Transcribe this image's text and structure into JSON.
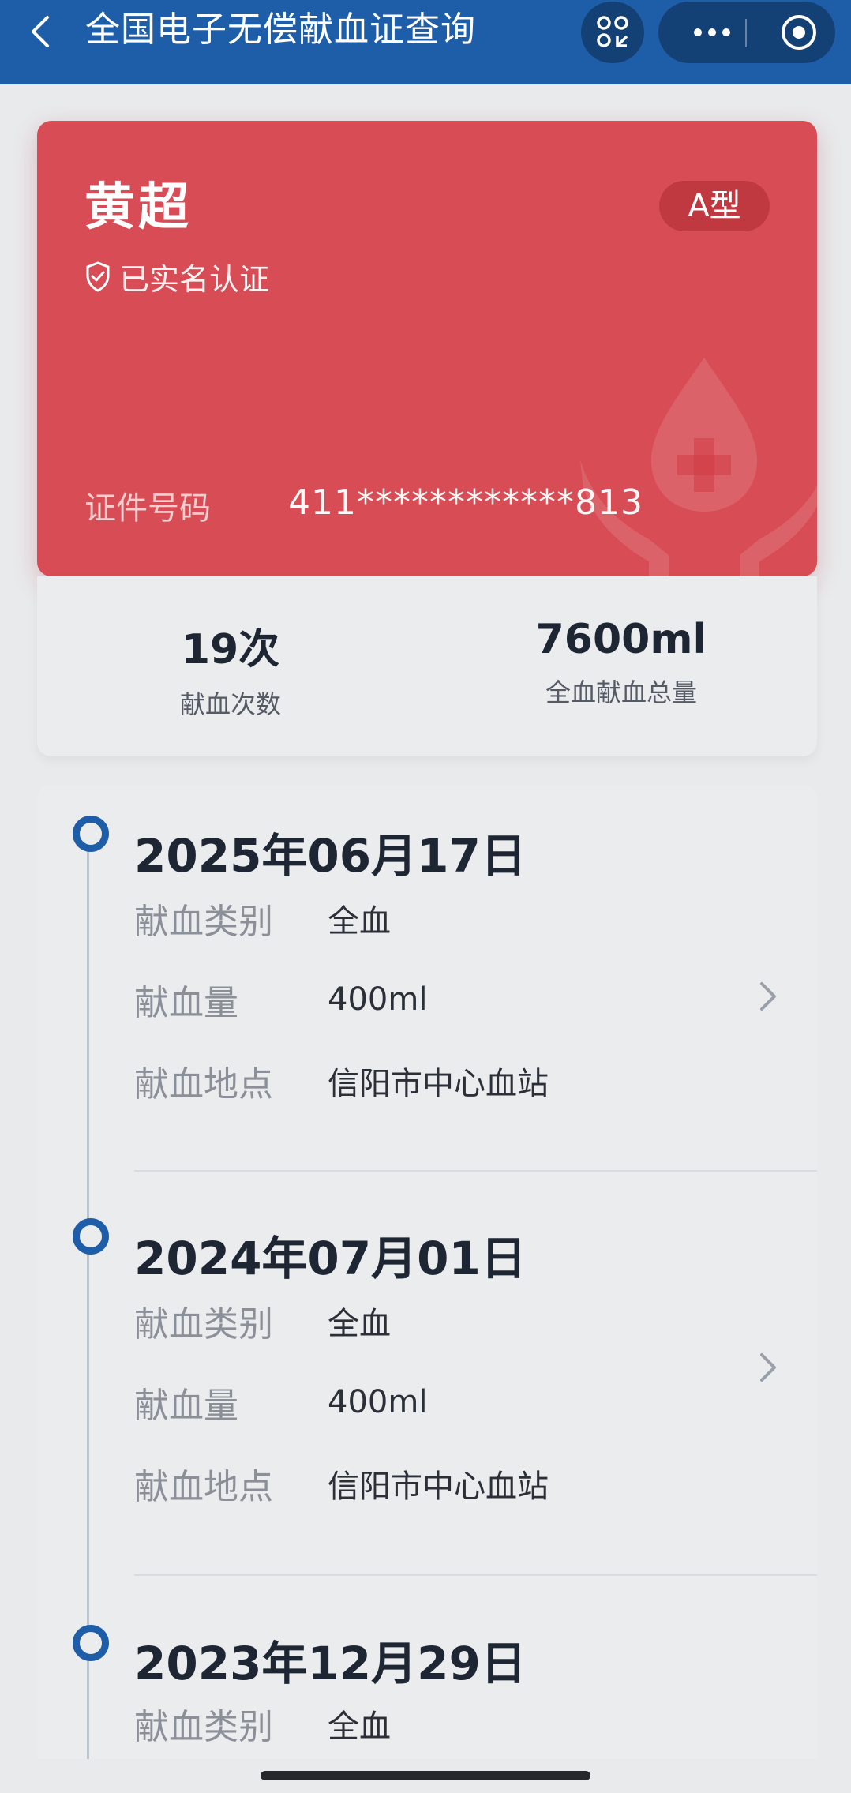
{
  "nav": {
    "title": "全国电子无偿献血证查询",
    "back_icon": "chevron-left-icon",
    "scan_icon": "scan-icon",
    "more_icon": "more-dots-icon",
    "close_icon": "target-circle-icon"
  },
  "card": {
    "name": "黄超",
    "verified_label": "已实名认证",
    "blood_type": "A型",
    "id_label": "证件号码",
    "id_value": "411************813"
  },
  "stats": {
    "count_value": "19次",
    "count_label": "献血次数",
    "volume_value": "7600ml",
    "volume_label": "全血献血总量"
  },
  "timeline": [
    {
      "date": "2025年06月17日",
      "rows": [
        {
          "label": "献血类别",
          "value": "全血"
        },
        {
          "label": "献血量",
          "value": "400ml"
        },
        {
          "label": "献血地点",
          "value": "信阳市中心血站"
        }
      ]
    },
    {
      "date": "2024年07月01日",
      "rows": [
        {
          "label": "献血类别",
          "value": "全血"
        },
        {
          "label": "献血量",
          "value": "400ml"
        },
        {
          "label": "献血地点",
          "value": "信阳市中心血站"
        }
      ]
    },
    {
      "date": "2023年12月29日",
      "rows": [
        {
          "label": "献血类别",
          "value": "全血"
        }
      ]
    }
  ],
  "colors": {
    "nav_bg": "#1E5DA8",
    "card_red": "#D84D55",
    "accent_blue": "#1E5DA8"
  }
}
